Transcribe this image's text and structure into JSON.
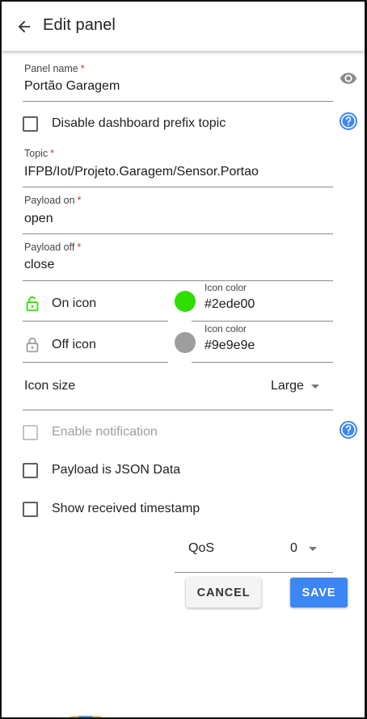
{
  "appbar": {
    "title": "Edit panel"
  },
  "panel_name": {
    "label": "Panel name",
    "required": "*",
    "value": "Portão Garagem"
  },
  "disable_prefix": {
    "label": "Disable dashboard prefix topic"
  },
  "topic": {
    "label": "Topic",
    "required": "*",
    "value": "IFPB/Iot/Projeto.Garagem/Sensor.Portao"
  },
  "payload_on": {
    "label": "Payload on",
    "required": "*",
    "value": "open"
  },
  "payload_off": {
    "label": "Payload off",
    "required": "*",
    "value": "close"
  },
  "on_icon": {
    "label": "On icon",
    "icon": "lock-open-icon",
    "color_label": "Icon color",
    "color_value": "#2ede00",
    "color": "#2ede00"
  },
  "off_icon": {
    "label": "Off icon",
    "icon": "lock-icon",
    "color_label": "Icon color",
    "color_value": "#9e9e9e",
    "color": "#9e9e9e"
  },
  "icon_size": {
    "label": "Icon size",
    "value": "Large"
  },
  "enable_notification": {
    "label": "Enable notification"
  },
  "payload_json": {
    "label": "Payload is JSON Data"
  },
  "show_timestamp": {
    "label": "Show received timestamp"
  },
  "qos": {
    "label": "QoS",
    "value": "0"
  },
  "actions": {
    "cancel": "CANCEL",
    "save": "SAVE"
  },
  "colors": {
    "accent": "#3d86f5",
    "help": "#3d86f5",
    "required": "#d32f2f"
  }
}
